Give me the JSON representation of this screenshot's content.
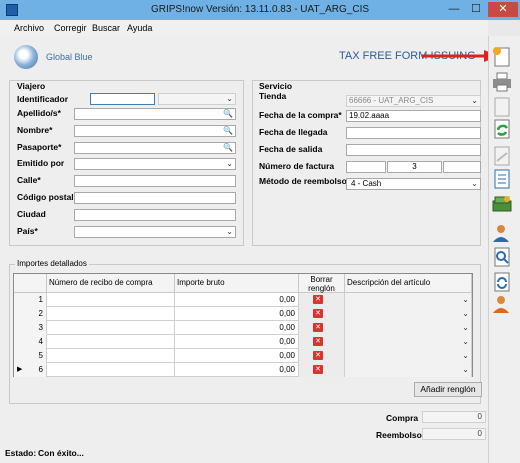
{
  "window": {
    "title": "GRIPS!now Versión: 13.11.0.83 - UAT_ARG_CIS",
    "min": "—",
    "max": "☐",
    "close": "✕"
  },
  "menu": [
    "Archivo",
    "Corregir",
    "Buscar",
    "Ayuda"
  ],
  "brand": {
    "name": "Global Blue",
    "banner": "TAX FREE FORM ISSUING"
  },
  "viajero": {
    "title": "Viajero",
    "labels": [
      "Identificador",
      "Apellido/s*",
      "Nombre*",
      "Pasaporte*",
      "Emitido por",
      "Calle*",
      "Código postal",
      "Ciudad",
      "País*"
    ]
  },
  "servicio": {
    "title": "Servicio",
    "tienda_label": "Tienda",
    "tienda_value": "66666 - UAT_ARG_CIS",
    "fecha_compra_label": "Fecha de la compra*",
    "fecha_compra_value": "19.02.aaaa",
    "fecha_llegada_label": "Fecha de llegada",
    "fecha_salida_label": "Fecha de salida",
    "factura_label": "Número de factura",
    "factura_mid": "3",
    "metodo_label": "Método de reembolso*",
    "metodo_value": "4 - Cash"
  },
  "importes": {
    "title": "Importes detallados",
    "headers": {
      "recibo": "Número de recibo de compra",
      "importe": "Importe bruto",
      "borrar": "Borrar renglón",
      "desc": "Descripción del artículo"
    },
    "rows": [
      {
        "n": "1",
        "importe": "0,00"
      },
      {
        "n": "2",
        "importe": "0,00"
      },
      {
        "n": "3",
        "importe": "0,00"
      },
      {
        "n": "4",
        "importe": "0,00"
      },
      {
        "n": "5",
        "importe": "0,00"
      },
      {
        "n": "6",
        "importe": "0,00"
      }
    ],
    "add_row": "Añadir renglón"
  },
  "totals": {
    "compra_label": "Compra",
    "compra_value": "0",
    "reembolso_label": "Reembolso",
    "reembolso_value": "0"
  },
  "status": {
    "label": "Estado:",
    "text": "Con éxito..."
  },
  "colors": {
    "arrow": "#e0201b",
    "titlebar": "#6fb1e4",
    "selection": "#3399ff"
  }
}
